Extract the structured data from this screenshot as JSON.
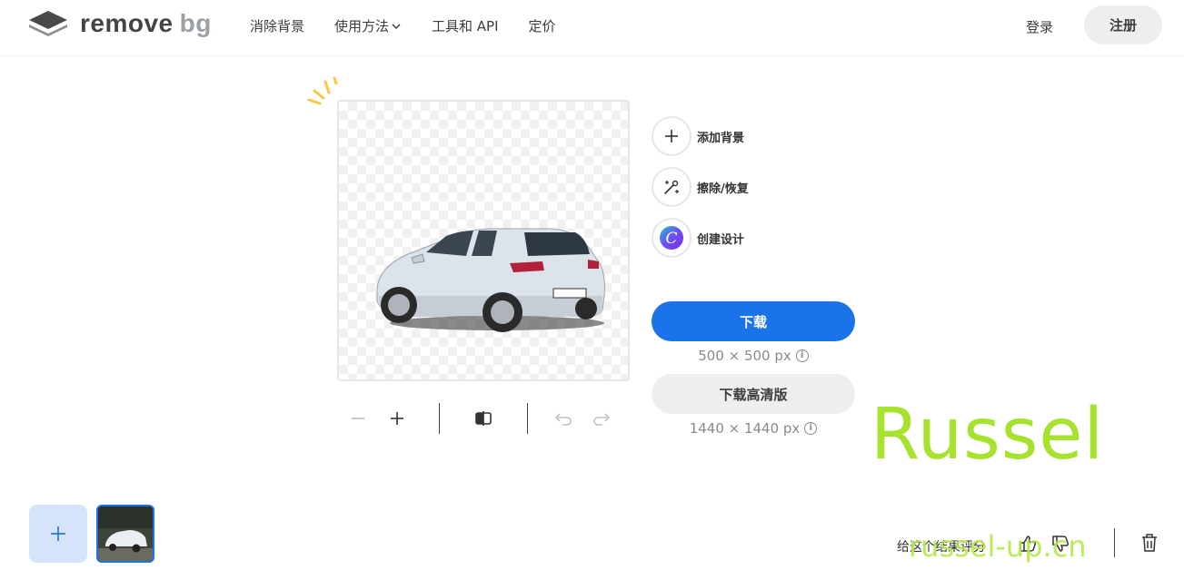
{
  "header": {
    "logo_text_1": "remove",
    "logo_text_2": "bg",
    "nav": [
      {
        "label": "消除背景"
      },
      {
        "label": "使用方法"
      },
      {
        "label": "工具和 API"
      },
      {
        "label": "定价"
      }
    ],
    "login_label": "登录",
    "signup_label": "注册"
  },
  "actions": {
    "add_background": "添加背景",
    "erase_restore": "擦除/恢复",
    "create_design": "创建设计"
  },
  "download": {
    "button_label": "下载",
    "size_label": "500 × 500 px",
    "hd_button_label": "下载高清版",
    "hd_size_label": "1440 × 1440 px"
  },
  "rating": {
    "prompt": "给这个结果评分"
  },
  "watermark": {
    "line1": "Russel",
    "line2": "russel-up.cn"
  },
  "colors": {
    "accent": "#1a73e8",
    "watermark": "#a6e22e"
  },
  "icons": [
    "logo-icon",
    "chevron-down-icon",
    "sparkle-icon",
    "plus-icon",
    "magic-brush-icon",
    "canva-icon",
    "info-icon",
    "zoom-out-icon",
    "zoom-in-icon",
    "compare-icon",
    "undo-icon",
    "redo-icon",
    "thumbs-up-icon",
    "thumbs-down-icon",
    "trash-icon"
  ]
}
